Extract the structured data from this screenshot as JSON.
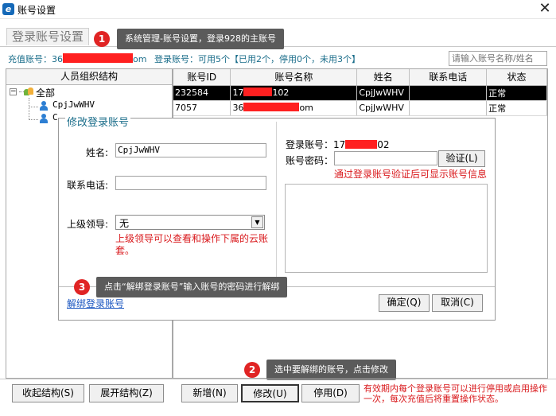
{
  "window": {
    "title": "账号设置",
    "app_icon": "app-logo-icon",
    "close_glyph": "✕"
  },
  "page_tab": {
    "label": "登录账号设置"
  },
  "info": {
    "recharge_label": "充值账号：",
    "recharge_prefix": "36",
    "recharge_suffix": "om",
    "login_summary": "登录账号：可用5个【已用2个，停用0个，未用3个】"
  },
  "search": {
    "placeholder": "请输入账号名称/姓名"
  },
  "tree": {
    "header": "人员组织结构",
    "root_label": "全部",
    "nodes": [
      "CpjJwWHV",
      "C"
    ]
  },
  "table": {
    "columns": [
      "账号ID",
      "账号名称",
      "姓名",
      "联系电话",
      "状态"
    ],
    "rows": [
      {
        "id": "232584",
        "name_prefix": "17",
        "name_suffix": "102",
        "person": "CpjJwWHV",
        "phone": "",
        "status": "正常"
      },
      {
        "id": "7057",
        "name_prefix": "36",
        "name_suffix": "om",
        "person": "CpjJwWHV",
        "phone": "",
        "status": "正常"
      }
    ]
  },
  "dialog": {
    "title": "修改登录账号",
    "name_label": "姓名:",
    "name_value": "CpjJwWHV",
    "phone_label": "联系电话:",
    "phone_value": "",
    "leader_label": "上级领导:",
    "leader_value": "无",
    "leader_note": "上级领导可以查看和操作下属的云账套。",
    "login_label": "登录账号：",
    "login_prefix": "17",
    "login_suffix": "02",
    "pwd_label": "账号密码：",
    "pwd_value": "",
    "verify_button": "验证(L)",
    "verify_note": "通过登录账号验证后可显示账号信息",
    "unbind_link": "解绑登录账号",
    "ok_button": "确定(Q)",
    "cancel_button": "取消(C)"
  },
  "footer": {
    "collapse_button": "收起结构(S)",
    "expand_button": "展开结构(Z)",
    "add_button": "新增(N)",
    "modify_button": "修改(U)",
    "disable_button": "停用(D)",
    "note": "有效期内每个登录账号可以进行停用或启用操作一次，每次充值后将重置操作状态。"
  },
  "callouts": [
    {
      "badge": "1",
      "text": "系统管理-账号设置，登录928的主账号"
    },
    {
      "badge": "2",
      "text": "选中要解绑的账号，点击修改"
    },
    {
      "badge": "3",
      "text": "点击“解绑登录账号”输入账号的密码进行解绑"
    }
  ],
  "colors": {
    "accent": "#1a6d8a",
    "redact": "#ff2020",
    "note_red": "#d9191c",
    "callout_bg": "#5b5b5b",
    "badge_red": "#e02424"
  }
}
